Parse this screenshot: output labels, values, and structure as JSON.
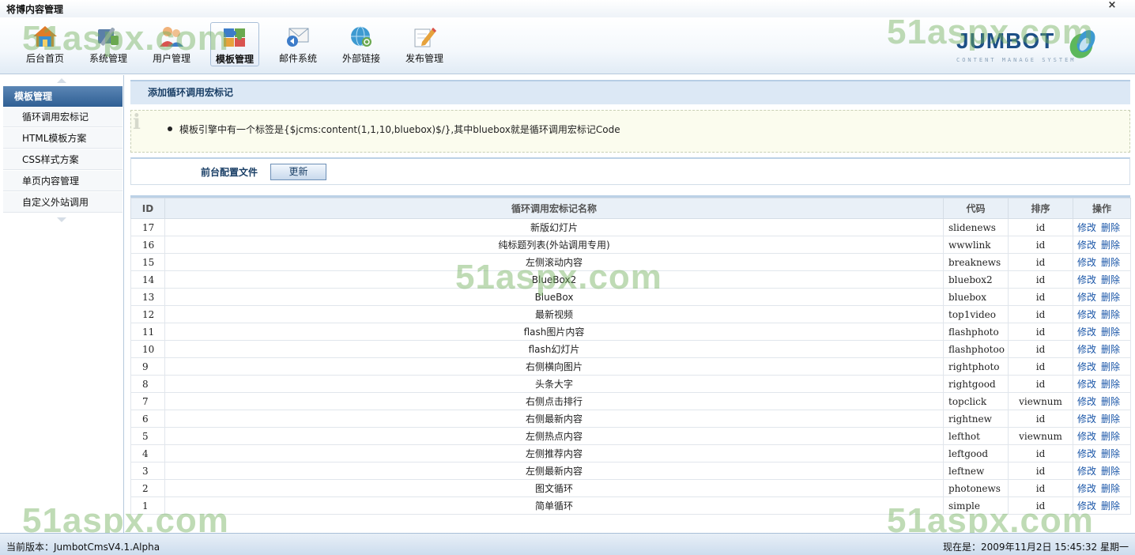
{
  "app": {
    "title": "将博内容管理",
    "close": "×"
  },
  "nav": [
    {
      "label": "后台首页",
      "icon": "home-icon"
    },
    {
      "label": "系统管理",
      "icon": "tools-icon"
    },
    {
      "label": "用户管理",
      "icon": "users-icon"
    },
    {
      "label": "模板管理",
      "icon": "puzzle-icon",
      "active": true
    },
    {
      "label": "邮件系统",
      "icon": "mail-icon"
    },
    {
      "label": "外部链接",
      "icon": "globe-link-icon"
    },
    {
      "label": "发布管理",
      "icon": "pencil-icon"
    }
  ],
  "logo": {
    "text": "JUMBOT",
    "sub": "CONTENT MANAGE SYSTEM"
  },
  "sidebar": {
    "title": "模板管理",
    "items": [
      {
        "label": "循环调用宏标记"
      },
      {
        "label": "HTML模板方案"
      },
      {
        "label": "CSS样式方案"
      },
      {
        "label": "单页内容管理"
      },
      {
        "label": "自定义外站调用"
      }
    ]
  },
  "main": {
    "title": "添加循环调用宏标记",
    "tip": "模板引擎中有一个标签是{$jcms:content(1,1,10,bluebox)$/},其中bluebox就是循环调用宏标记Code",
    "config": {
      "label": "前台配置文件",
      "button": "更新"
    },
    "table": {
      "headers": {
        "id": "ID",
        "name": "循环调用宏标记名称",
        "code": "代码",
        "sort": "排序",
        "actions": "操作"
      },
      "edit_label": "修改",
      "delete_label": "删除",
      "rows": [
        {
          "id": "17",
          "name": "新版幻灯片",
          "code": "slidenews",
          "sort": "id"
        },
        {
          "id": "16",
          "name": "纯标题列表(外站调用专用)",
          "code": "wwwlink",
          "sort": "id"
        },
        {
          "id": "15",
          "name": "左侧滚动内容",
          "code": "breaknews",
          "sort": "id"
        },
        {
          "id": "14",
          "name": "BlueBox2",
          "code": "bluebox2",
          "sort": "id"
        },
        {
          "id": "13",
          "name": "BlueBox",
          "code": "bluebox",
          "sort": "id"
        },
        {
          "id": "12",
          "name": "最新视频",
          "code": "top1video",
          "sort": "id"
        },
        {
          "id": "11",
          "name": "flash图片内容",
          "code": "flashphoto",
          "sort": "id"
        },
        {
          "id": "10",
          "name": "flash幻灯片",
          "code": "flashphotoo",
          "sort": "id"
        },
        {
          "id": "9",
          "name": "右侧横向图片",
          "code": "rightphoto",
          "sort": "id"
        },
        {
          "id": "8",
          "name": "头条大字",
          "code": "rightgood",
          "sort": "id"
        },
        {
          "id": "7",
          "name": "右侧点击排行",
          "code": "topclick",
          "sort": "viewnum"
        },
        {
          "id": "6",
          "name": "右侧最新内容",
          "code": "rightnew",
          "sort": "id"
        },
        {
          "id": "5",
          "name": "左侧热点内容",
          "code": "lefthot",
          "sort": "viewnum"
        },
        {
          "id": "4",
          "name": "左侧推荐内容",
          "code": "leftgood",
          "sort": "id"
        },
        {
          "id": "3",
          "name": "左侧最新内容",
          "code": "leftnew",
          "sort": "id"
        },
        {
          "id": "2",
          "name": "图文循环",
          "code": "photonews",
          "sort": "id"
        },
        {
          "id": "1",
          "name": "简单循环",
          "code": "simple",
          "sort": "id"
        }
      ]
    }
  },
  "watermark": "51aspx.com",
  "status": {
    "version": "当前版本：JumbotCmsV4.1.Alpha",
    "datetime": "现在是：2009年11月2日 15:45:32  星期一"
  },
  "colors": {
    "accent": "#2f5f94",
    "link": "#1a56a8",
    "watermark": "#70b05c"
  }
}
